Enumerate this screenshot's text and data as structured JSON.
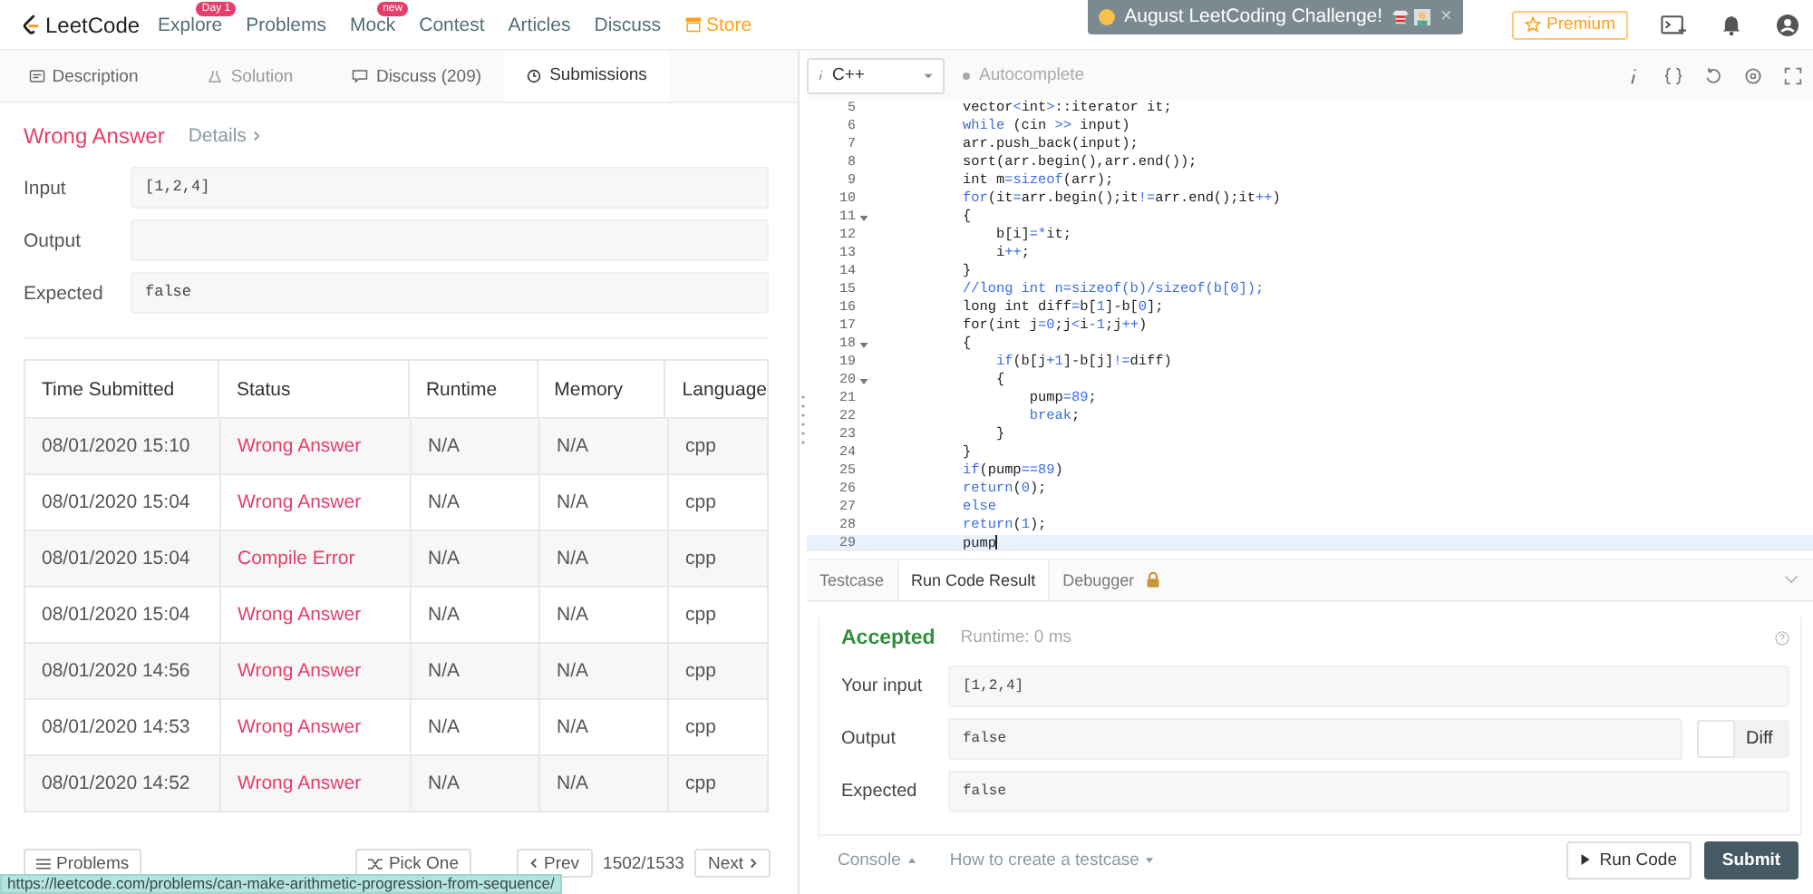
{
  "nav": {
    "logo": "LeetCode",
    "items": [
      {
        "label": "Explore",
        "badge": "Day 1",
        "highlight": false
      },
      {
        "label": "Problems",
        "highlight": false
      },
      {
        "label": "Mock",
        "badge": "new",
        "highlight": false
      },
      {
        "label": "Contest",
        "highlight": false
      },
      {
        "label": "Articles",
        "highlight": false
      },
      {
        "label": "Discuss",
        "highlight": false
      },
      {
        "label": "Store",
        "highlight": true
      }
    ],
    "banner": {
      "text": "August LeetCoding Challenge!",
      "close": "×"
    },
    "premium": "Premium"
  },
  "left": {
    "tabs": [
      {
        "label": "Description",
        "selected": false,
        "disabled": false,
        "kind": "doc"
      },
      {
        "label": "Solution",
        "selected": false,
        "disabled": true,
        "kind": "flask"
      },
      {
        "label": "Discuss (209)",
        "selected": false,
        "disabled": false,
        "kind": "chat"
      },
      {
        "label": "Submissions",
        "selected": true,
        "disabled": false,
        "kind": "clock"
      }
    ],
    "result": {
      "status": "Wrong Answer",
      "details": "Details",
      "fields": [
        {
          "label": "Input",
          "value": "[1,2,4]"
        },
        {
          "label": "Output"
        },
        {
          "label": "Expected",
          "value": "false"
        }
      ]
    },
    "table": {
      "columns": [
        "Time Submitted",
        "Status",
        "Runtime",
        "Memory",
        "Language"
      ],
      "rows": [
        [
          "08/01/2020 15:10",
          "Wrong Answer",
          "N/A",
          "N/A",
          "cpp"
        ],
        [
          "08/01/2020 15:04",
          "Wrong Answer",
          "N/A",
          "N/A",
          "cpp"
        ],
        [
          "08/01/2020 15:04",
          "Compile Error",
          "N/A",
          "N/A",
          "cpp"
        ],
        [
          "08/01/2020 15:04",
          "Wrong Answer",
          "N/A",
          "N/A",
          "cpp"
        ],
        [
          "08/01/2020 14:56",
          "Wrong Answer",
          "N/A",
          "N/A",
          "cpp"
        ],
        [
          "08/01/2020 14:53",
          "Wrong Answer",
          "N/A",
          "N/A",
          "cpp"
        ],
        [
          "08/01/2020 14:52",
          "Wrong Answer",
          "N/A",
          "N/A",
          "cpp"
        ]
      ]
    },
    "footer": {
      "problems": "Problems",
      "pick_one": "Pick One",
      "prev": "Prev",
      "page": "1502/1533",
      "next": "Next"
    }
  },
  "editor": {
    "language": "C++",
    "autocomplete": {
      "label": "Autocomplete",
      "on": false
    },
    "lines": [
      {
        "num": "5",
        "fold": false,
        "active": false,
        "segs": [
          {
            "text": "vector",
            "kind": "plain"
          },
          {
            "text": "<",
            "kind": "keyword"
          },
          {
            "text": "int",
            "kind": "plain"
          },
          {
            "text": ">",
            "kind": "keyword"
          },
          {
            "text": "::iterator it;",
            "kind": "plain"
          }
        ]
      },
      {
        "num": "6",
        "fold": false,
        "active": false,
        "segs": [
          {
            "text": "while",
            "kind": "keyword"
          },
          {
            "text": " (cin ",
            "kind": "plain"
          },
          {
            "text": ">>",
            "kind": "keyword"
          },
          {
            "text": " input)",
            "kind": "plain"
          }
        ]
      },
      {
        "num": "7",
        "fold": false,
        "active": false,
        "segs": [
          {
            "text": "arr.push_back(input);",
            "kind": "plain"
          }
        ]
      },
      {
        "num": "8",
        "fold": false,
        "active": false,
        "segs": [
          {
            "text": "sort(arr.begin(),arr.end());",
            "kind": "plain"
          }
        ]
      },
      {
        "num": "9",
        "fold": false,
        "active": false,
        "segs": [
          {
            "text": "int m",
            "kind": "plain"
          },
          {
            "text": "=sizeof",
            "kind": "keyword"
          },
          {
            "text": "(arr);",
            "kind": "plain"
          }
        ]
      },
      {
        "num": "10",
        "fold": false,
        "active": false,
        "segs": [
          {
            "text": "for",
            "kind": "keyword"
          },
          {
            "text": "(it",
            "kind": "plain"
          },
          {
            "text": "=",
            "kind": "keyword"
          },
          {
            "text": "arr.begin();it",
            "kind": "plain"
          },
          {
            "text": "!=",
            "kind": "keyword"
          },
          {
            "text": "arr.end();it",
            "kind": "plain"
          },
          {
            "text": "++",
            "kind": "keyword"
          },
          {
            "text": ")",
            "kind": "plain"
          }
        ]
      },
      {
        "num": "11",
        "fold": true,
        "active": false,
        "segs": [
          {
            "text": "{",
            "kind": "plain"
          }
        ]
      },
      {
        "num": "12",
        "fold": false,
        "active": false,
        "segs": [
          {
            "text": "    b[i]",
            "kind": "plain"
          },
          {
            "text": "=*",
            "kind": "keyword"
          },
          {
            "text": "it;",
            "kind": "plain"
          }
        ]
      },
      {
        "num": "13",
        "fold": false,
        "active": false,
        "segs": [
          {
            "text": "    i",
            "kind": "plain"
          },
          {
            "text": "++",
            "kind": "keyword"
          },
          {
            "text": ";",
            "kind": "plain"
          }
        ]
      },
      {
        "num": "14",
        "fold": false,
        "active": false,
        "segs": [
          {
            "text": "}",
            "kind": "plain"
          }
        ]
      },
      {
        "num": "15",
        "fold": false,
        "active": false,
        "segs": [
          {
            "text": "//long int n=sizeof(b)/sizeof(b[0]);",
            "kind": "keyword"
          }
        ]
      },
      {
        "num": "16",
        "fold": false,
        "active": false,
        "segs": [
          {
            "text": "long int diff",
            "kind": "plain"
          },
          {
            "text": "=",
            "kind": "keyword"
          },
          {
            "text": "b[",
            "kind": "plain"
          },
          {
            "text": "1",
            "kind": "keyword"
          },
          {
            "text": "]-b[",
            "kind": "plain"
          },
          {
            "text": "0",
            "kind": "keyword"
          },
          {
            "text": "];",
            "kind": "plain"
          }
        ]
      },
      {
        "num": "17",
        "fold": false,
        "active": false,
        "segs": [
          {
            "text": "for(int j",
            "kind": "plain"
          },
          {
            "text": "=0",
            "kind": "keyword"
          },
          {
            "text": ";j",
            "kind": "plain"
          },
          {
            "text": "<",
            "kind": "keyword"
          },
          {
            "text": "i",
            "kind": "plain"
          },
          {
            "text": "-1",
            "kind": "keyword"
          },
          {
            "text": ";j",
            "kind": "plain"
          },
          {
            "text": "++",
            "kind": "keyword"
          },
          {
            "text": ")",
            "kind": "plain"
          }
        ]
      },
      {
        "num": "18",
        "fold": true,
        "active": false,
        "segs": [
          {
            "text": "{",
            "kind": "plain"
          }
        ]
      },
      {
        "num": "19",
        "fold": false,
        "active": false,
        "segs": [
          {
            "text": "    if",
            "kind": "keyword"
          },
          {
            "text": "(b[j",
            "kind": "plain"
          },
          {
            "text": "+1",
            "kind": "keyword"
          },
          {
            "text": "]-b[j]",
            "kind": "plain"
          },
          {
            "text": "!=",
            "kind": "keyword"
          },
          {
            "text": "diff)",
            "kind": "plain"
          }
        ]
      },
      {
        "num": "20",
        "fold": true,
        "active": false,
        "segs": [
          {
            "text": "    {",
            "kind": "plain"
          }
        ]
      },
      {
        "num": "21",
        "fold": false,
        "active": false,
        "segs": [
          {
            "text": "        pump",
            "kind": "plain"
          },
          {
            "text": "=89",
            "kind": "keyword"
          },
          {
            "text": ";",
            "kind": "plain"
          }
        ]
      },
      {
        "num": "22",
        "fold": false,
        "active": false,
        "segs": [
          {
            "text": "        break",
            "kind": "keyword"
          },
          {
            "text": ";",
            "kind": "plain"
          }
        ]
      },
      {
        "num": "23",
        "fold": false,
        "active": false,
        "segs": [
          {
            "text": "    }",
            "kind": "plain"
          }
        ]
      },
      {
        "num": "24",
        "fold": false,
        "active": false,
        "segs": [
          {
            "text": "}",
            "kind": "plain"
          }
        ]
      },
      {
        "num": "25",
        "fold": false,
        "active": false,
        "segs": [
          {
            "text": "if",
            "kind": "keyword"
          },
          {
            "text": "(pump",
            "kind": "plain"
          },
          {
            "text": "==89",
            "kind": "keyword"
          },
          {
            "text": ")",
            "kind": "plain"
          }
        ]
      },
      {
        "num": "26",
        "fold": false,
        "active": false,
        "segs": [
          {
            "text": "return",
            "kind": "keyword"
          },
          {
            "text": "(",
            "kind": "plain"
          },
          {
            "text": "0",
            "kind": "keyword"
          },
          {
            "text": ");",
            "kind": "plain"
          }
        ]
      },
      {
        "num": "27",
        "fold": false,
        "active": false,
        "segs": [
          {
            "text": "else",
            "kind": "keyword"
          }
        ]
      },
      {
        "num": "28",
        "fold": false,
        "active": false,
        "segs": [
          {
            "text": "return",
            "kind": "keyword"
          },
          {
            "text": "(",
            "kind": "plain"
          },
          {
            "text": "1",
            "kind": "keyword"
          },
          {
            "text": ");",
            "kind": "plain"
          }
        ]
      },
      {
        "num": "29",
        "fold": false,
        "active": true,
        "segs": [
          {
            "text": "pump",
            "kind": "plain"
          }
        ]
      }
    ]
  },
  "console": {
    "tabs": [
      {
        "label": "Testcase",
        "selected": false,
        "locked": false
      },
      {
        "label": "Run Code Result",
        "selected": true,
        "locked": false
      },
      {
        "label": "Debugger",
        "selected": false,
        "locked": true
      }
    ],
    "status": "Accepted",
    "runtime": "Runtime: 0 ms",
    "fields": [
      {
        "label": "Your input",
        "value": "[1,2,4]",
        "diff": false
      },
      {
        "label": "Output",
        "value": "false",
        "diff": true
      },
      {
        "label": "Expected",
        "value": "false",
        "diff": false
      }
    ],
    "diff": {
      "label": "Diff",
      "on": false
    },
    "footer": {
      "console": "Console",
      "help": "How to create a testcase",
      "run": "Run Code",
      "submit": "Submit"
    }
  },
  "status_url": "https://leetcode.com/problems/can-make-arithmetic-progression-from-sequence/"
}
